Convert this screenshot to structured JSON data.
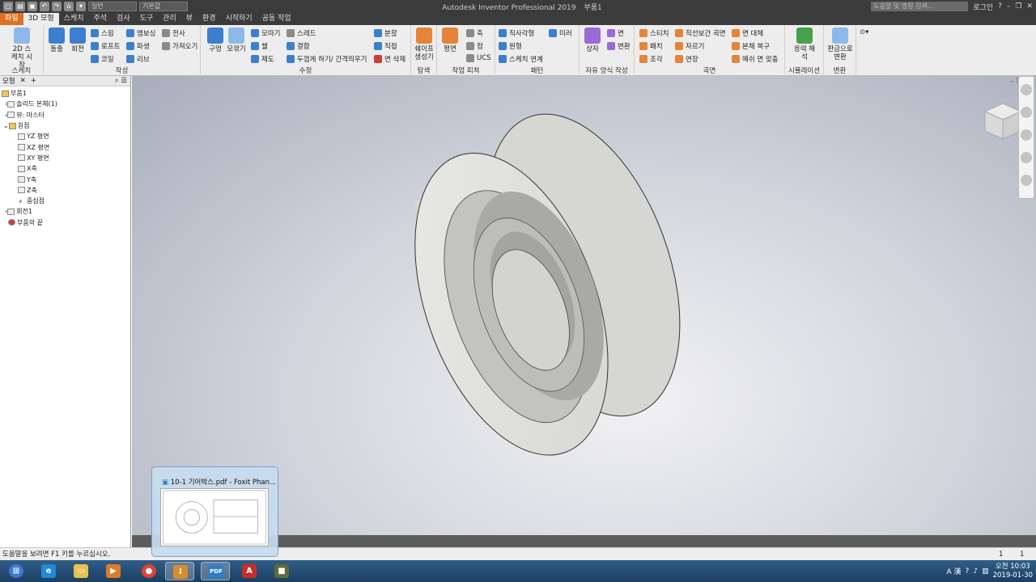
{
  "title_bar": {
    "app_title": "Autodesk Inventor Professional 2019",
    "doc_name": "부품1",
    "search_placeholder": "도움말 및 명령 검색...",
    "login": "로그인",
    "material": "일반",
    "appearance": "기본값"
  },
  "tabs": [
    "파일",
    "3D 모형",
    "스케치",
    "주석",
    "검사",
    "도구",
    "관리",
    "뷰",
    "환경",
    "시작하기",
    "공동 작업"
  ],
  "ribbon": {
    "sketch": {
      "title": "스케치",
      "btn": "2D 스케치 시작"
    },
    "create": {
      "title": "작성",
      "extrude": "돌출",
      "revolve": "회전",
      "sweep": "스윕",
      "loft": "로프트",
      "coil": "코일",
      "emboss": "엠보싱",
      "derive": "파생",
      "rib": "리브",
      "decal": "전사",
      "import": "가져오기"
    },
    "modify": {
      "title": "수정",
      "hole": "구멍",
      "fillet": "모깎기",
      "chamfer": "모따기",
      "shell": "쉘",
      "draft": "제도",
      "thread": "스레드",
      "combine": "결합",
      "thicken": "두껍게 하기/ 간격띄우기",
      "split": "분할",
      "direct": "직접",
      "delete_face": "면 삭제"
    },
    "explore": {
      "title": "탐색",
      "shape": "쉐이프 생성기"
    },
    "work": {
      "title": "작업 피쳐",
      "plane": "평면",
      "axis": "축",
      "point": "점",
      "ucs": "UCS"
    },
    "pattern": {
      "title": "패턴",
      "rect": "직사각형",
      "circ": "원형",
      "sk": "스케치 연계",
      "mirror": "미러"
    },
    "freeform": {
      "title": "자유 양식 작성",
      "box": "상자",
      "face": "면",
      "convert": "변환"
    },
    "surface": {
      "title": "곡면",
      "stitch": "스티치",
      "patch": "패치",
      "sculpt": "조각",
      "ruled": "직선보간 곡면",
      "trim": "자르기",
      "extend": "연장",
      "replace": "면 대체",
      "repair": "본체 복구",
      "fit": "메쉬 면 맞춤"
    },
    "simulation": {
      "title": "시뮬레이션",
      "stress": "응력 해석"
    },
    "convert": {
      "title": "변환",
      "sheet": "판금으로 변환"
    }
  },
  "browser": {
    "tab": "모형",
    "items": [
      "부품1",
      "솔리드 본체(1)",
      "뷰: 마스터",
      "원점",
      "YZ 평면",
      "XZ 평면",
      "XY 평면",
      "X축",
      "Y축",
      "Z축",
      "중심점",
      "회전1",
      "부품의 끝"
    ]
  },
  "status": {
    "help": "도움말을 보려면 F1 키를 누르십시오.",
    "n1": "1",
    "n2": "1"
  },
  "taskbar": {
    "preview_title": "10-1 기어박스.pdf - Foxit Phan...",
    "time": "오전 10:03",
    "date": "2019-01-30"
  }
}
